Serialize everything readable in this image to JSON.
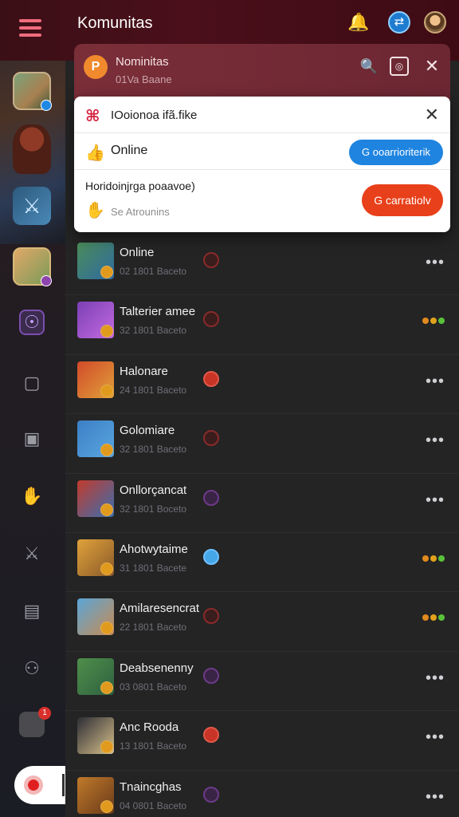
{
  "header": {
    "title": "Komunitas",
    "icons": [
      "menu-icon",
      "bell-icon",
      "profile-switch-icon",
      "user-avatar"
    ]
  },
  "sidebar": {
    "icons": [
      "game-tile-1",
      "hero-figure",
      "game-tile-2",
      "game-tile-3",
      "quest-icon",
      "tile-icon-a",
      "tile-icon-b",
      "gesture-icon",
      "sword-icon",
      "table-icon",
      "group-icon",
      "notifications-icon"
    ],
    "notification_badge": "1"
  },
  "notification": {
    "title": "Nominitas",
    "subtitle": "01Va Baane",
    "icons": [
      "key-icon",
      "camera-icon",
      "close-icon"
    ]
  },
  "dialog": {
    "title": "IOoionoa ifã.fike",
    "close": "✕",
    "online_label": "Online",
    "blue_button": "G ooarrioriterik",
    "description": "Horidoinjrga poaavoe)",
    "sub_label": "Se Atrounins",
    "red_button": "G carratiolv"
  },
  "list": [
    {
      "name": "Online",
      "sub": "02  1801 Baceto",
      "status": "dark",
      "right": "more",
      "thumb": [
        "#4c8d5a",
        "#2e6aa0"
      ]
    },
    {
      "name": "Talterier amee",
      "sub": "32  1801 Baceto",
      "status": "dark",
      "right": "dots",
      "thumb": [
        "#7b3fb5",
        "#c46be0"
      ]
    },
    {
      "name": "Halonare",
      "sub": "24  1801 Baceto",
      "status": "red",
      "right": "more",
      "thumb": [
        "#d24a2a",
        "#e0a13a"
      ]
    },
    {
      "name": "Golomiare",
      "sub": "32  1801 Baceto",
      "status": "dark",
      "right": "more",
      "thumb": [
        "#3b7fc4",
        "#5aa6e0"
      ]
    },
    {
      "name": "Onllorçancat",
      "sub": "32  1801 Boceto",
      "status": "purple",
      "right": "more",
      "thumb": [
        "#c23a2c",
        "#3a6fb0"
      ]
    },
    {
      "name": "Ahotwytaime",
      "sub": "31  1801 Bacete",
      "status": "blue",
      "right": "dots",
      "thumb": [
        "#e0a23a",
        "#8a5a2a"
      ]
    },
    {
      "name": "Amilaresencrat",
      "sub": "22  1801 Baceto",
      "status": "dark",
      "right": "dots",
      "thumb": [
        "#5aa6d8",
        "#c88a50"
      ]
    },
    {
      "name": "Deabsenenny",
      "sub": "03  0801 Baceto",
      "status": "purple",
      "right": "more",
      "thumb": [
        "#4f8f4a",
        "#2e6040"
      ]
    },
    {
      "name": "Anc Rooda",
      "sub": "13  1801 Baceto",
      "status": "red",
      "right": "more",
      "thumb": [
        "#2c2c36",
        "#d8c28a"
      ]
    },
    {
      "name": "Tnaincghas",
      "sub": "04  0801 Baceto",
      "status": "purple",
      "right": "more",
      "thumb": [
        "#c07a2a",
        "#6a3a1a"
      ]
    }
  ],
  "colors": {
    "accent_red": "#e8401a",
    "accent_blue": "#1f84e0",
    "header_bg": "#4a0f1a"
  }
}
